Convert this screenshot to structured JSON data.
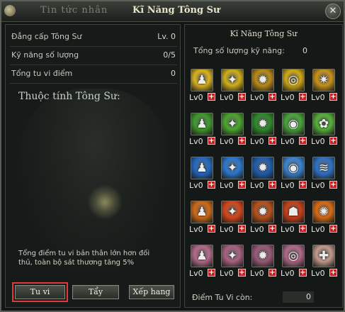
{
  "window": {
    "tab_inactive": "Tin tức nhân",
    "tab_active": "Kĩ Năng Tông Sư",
    "close_glyph": "✕"
  },
  "left_panel": {
    "stats": [
      {
        "label": "Đẳng cấp Tông Sư",
        "value": "Lv. 0"
      },
      {
        "label": "Kỹ năng số lượng",
        "value": "0/5"
      },
      {
        "label": "Tổng tu vi điểm",
        "value": "0"
      }
    ],
    "attributes_title": "Thuộc tính Tông Sư:",
    "description": "Tổng điểm tu vi bản thân lớn hơn đối thủ, toàn bộ sát thương tăng 5%",
    "buttons": {
      "tu_vi": "Tu vi",
      "tay": "Tẩy",
      "xep_hang": "Xếp hang"
    }
  },
  "right_panel": {
    "title": "Kĩ Năng Tông Sư",
    "total_label": "Tổng số lượng kỹ năng:",
    "total_value": "0",
    "remaining_label": "Điểm Tu Vi còn:",
    "remaining_value": "0",
    "skills": [
      {
        "row": 0,
        "icon": "warrior-figure-icon",
        "glyph": "♟",
        "color": "#d9b320",
        "level": "Lv0"
      },
      {
        "row": 0,
        "icon": "wing-blade-icon",
        "glyph": "✦",
        "color": "#cfae1a",
        "level": "Lv0"
      },
      {
        "row": 0,
        "icon": "burst-arrows-icon",
        "glyph": "✹",
        "color": "#b98a16",
        "level": "Lv0"
      },
      {
        "row": 0,
        "icon": "spiral-icon",
        "glyph": "◎",
        "color": "#d1a915",
        "level": "Lv0"
      },
      {
        "row": 0,
        "icon": "flame-shield-icon",
        "glyph": "✷",
        "color": "#c8921a",
        "level": "Lv0"
      },
      {
        "row": 1,
        "icon": "warrior-figure-icon",
        "glyph": "♟",
        "color": "#3f9a2a",
        "level": "Lv0"
      },
      {
        "row": 1,
        "icon": "wing-blade-icon",
        "glyph": "✦",
        "color": "#4aa52d",
        "level": "Lv0"
      },
      {
        "row": 1,
        "icon": "burst-arrows-icon",
        "glyph": "✹",
        "color": "#2f8a2b",
        "level": "Lv0"
      },
      {
        "row": 1,
        "icon": "vortex-icon",
        "glyph": "◉",
        "color": "#48a63b",
        "level": "Lv0"
      },
      {
        "row": 1,
        "icon": "lotus-icon",
        "glyph": "✿",
        "color": "#56b03a",
        "level": "Lv0"
      },
      {
        "row": 2,
        "icon": "warrior-figure-icon",
        "glyph": "♟",
        "color": "#2469c2",
        "level": "Lv0"
      },
      {
        "row": 2,
        "icon": "wing-blade-icon",
        "glyph": "✦",
        "color": "#2b78cf",
        "level": "Lv0"
      },
      {
        "row": 2,
        "icon": "burst-arrows-icon",
        "glyph": "✹",
        "color": "#1f5fae",
        "level": "Lv0"
      },
      {
        "row": 2,
        "icon": "vortex-icon",
        "glyph": "◉",
        "color": "#3a84d2",
        "level": "Lv0"
      },
      {
        "row": 2,
        "icon": "wave-icon",
        "glyph": "≋",
        "color": "#2f72c4",
        "level": "Lv0"
      },
      {
        "row": 3,
        "icon": "warrior-figure-icon",
        "glyph": "♟",
        "color": "#d06a16",
        "level": "Lv0"
      },
      {
        "row": 3,
        "icon": "wing-blade-icon",
        "glyph": "✦",
        "color": "#d4471a",
        "level": "Lv0"
      },
      {
        "row": 3,
        "icon": "burst-arrows-icon",
        "glyph": "✹",
        "color": "#b8501a",
        "level": "Lv0"
      },
      {
        "row": 3,
        "icon": "demon-icon",
        "glyph": "☗",
        "color": "#c8401a",
        "level": "Lv0"
      },
      {
        "row": 3,
        "icon": "fire-burst-icon",
        "glyph": "✺",
        "color": "#d86a14",
        "level": "Lv0"
      },
      {
        "row": 4,
        "icon": "warrior-figure-icon",
        "glyph": "♟",
        "color": "#b36b8a",
        "level": "Lv0"
      },
      {
        "row": 4,
        "icon": "wing-blade-icon",
        "glyph": "✦",
        "color": "#a8627f",
        "level": "Lv0"
      },
      {
        "row": 4,
        "icon": "burst-arrows-icon",
        "glyph": "✹",
        "color": "#9a5a78",
        "level": "Lv0"
      },
      {
        "row": 4,
        "icon": "spiral-icon",
        "glyph": "◎",
        "color": "#b06a88",
        "level": "Lv0"
      },
      {
        "row": 4,
        "icon": "cross-emblem-icon",
        "glyph": "✚",
        "color": "#c09a8a",
        "level": "Lv0"
      }
    ]
  }
}
